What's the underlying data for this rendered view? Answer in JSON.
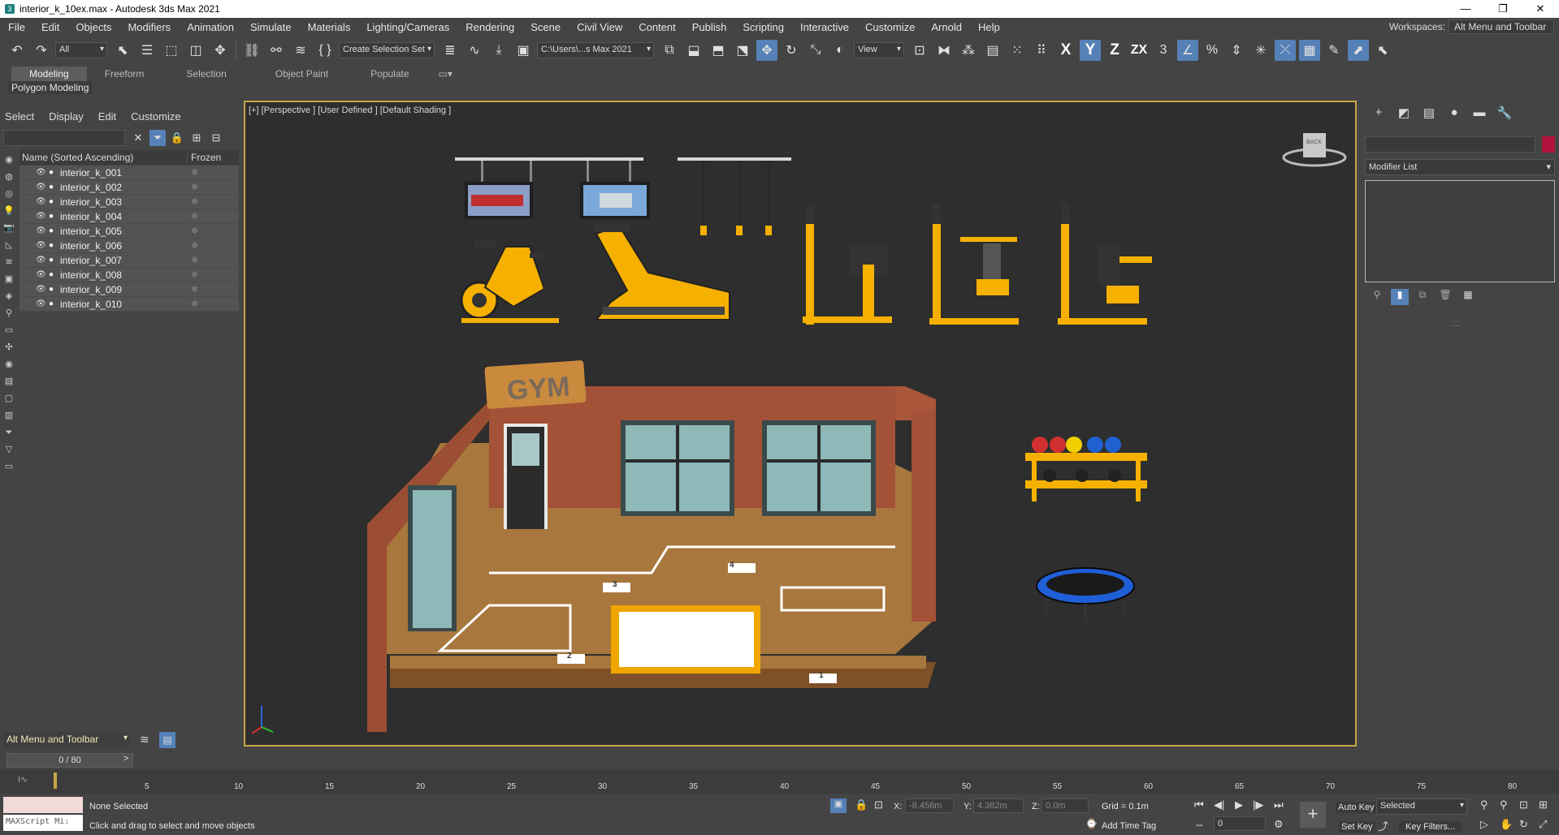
{
  "titlebar": {
    "title": "interior_k_10ex.max - Autodesk 3ds Max 2021",
    "minimize": "—",
    "maximize": "❐",
    "close": "✕"
  },
  "menu": [
    "File",
    "Edit",
    "Objects",
    "Modifiers",
    "Animation",
    "Simulate",
    "Materials",
    "Lighting/Cameras",
    "Rendering",
    "Scene",
    "Civil View",
    "Content",
    "Publish",
    "Scripting",
    "Interactive",
    "Customize",
    "Arnold",
    "Help"
  ],
  "workspace": {
    "label": "Workspaces:",
    "value": "Alt Menu and Toolbar"
  },
  "toolbar": {
    "filter_value": "All",
    "selection_set": "Create Selection Set",
    "path": "C:\\Users\\...s Max 2021",
    "view_dropdown": "View",
    "axis_x": "X",
    "axis_y": "Y",
    "axis_z": "Z",
    "axis_zx": "ZX"
  },
  "ribbon": {
    "tabs": [
      "Modeling",
      "Freeform",
      "Selection",
      "Object Paint",
      "Populate"
    ],
    "active_tab": "Modeling",
    "sub_label": "Polygon Modeling"
  },
  "scene_explorer": {
    "menu": [
      "Select",
      "Display",
      "Edit",
      "Customize"
    ],
    "col_name": "Name (Sorted Ascending)",
    "col_frozen": "Frozen",
    "objects": [
      "interior_k_001",
      "interior_k_002",
      "interior_k_003",
      "interior_k_004",
      "interior_k_005",
      "interior_k_006",
      "interior_k_007",
      "interior_k_008",
      "interior_k_009",
      "interior_k_010"
    ]
  },
  "viewport": {
    "label": "[+] [Perspective ] [User Defined ] [Default Shading ]",
    "sign_text": "GYM",
    "floor_numbers": [
      "4",
      "3",
      "2",
      "1"
    ],
    "viewcube_text": "BACK"
  },
  "command_panel": {
    "modifier_list": "Modifier List",
    "color": "#b0143c"
  },
  "workspace_bar": {
    "value": "Alt Menu and Toolbar"
  },
  "timeslider": {
    "frame": "0 / 80"
  },
  "timeline_ticks": [
    "5",
    "10",
    "15",
    "20",
    "25",
    "30",
    "35",
    "40",
    "45",
    "50",
    "55",
    "60",
    "65",
    "70",
    "75",
    "80"
  ],
  "status": {
    "selection": "None Selected",
    "prompt": "Click and drag to select and move objects",
    "maxscript": "MAXScript Mi:",
    "x_label": "X:",
    "x_value": "-8.456m",
    "y_label": "Y:",
    "y_value": "4.382m",
    "z_label": "Z:",
    "z_value": "0.0m",
    "grid": "Grid = 0.1m",
    "add_time_tag": "Add Time Tag",
    "auto_key": "Auto Key",
    "set_key": "Set Key",
    "selected": "Selected",
    "key_filters": "Key Filters...",
    "frame_field": "0"
  }
}
